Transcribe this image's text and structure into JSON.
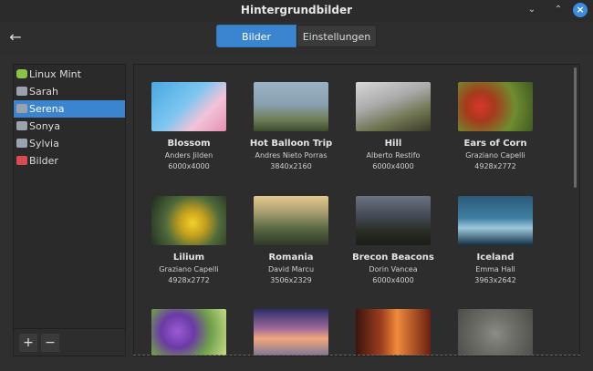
{
  "window": {
    "title": "Hintergrundbilder"
  },
  "header": {
    "back_icon": "arrow-left-icon",
    "tabs": [
      {
        "label": "Bilder",
        "active": true
      },
      {
        "label": "Einstellungen",
        "active": false
      }
    ]
  },
  "sidebar": {
    "items": [
      {
        "label": "Linux Mint",
        "icon": "linux-mint-icon",
        "active": false
      },
      {
        "label": "Sarah",
        "icon": "folder-icon",
        "active": false
      },
      {
        "label": "Serena",
        "icon": "folder-icon",
        "active": true
      },
      {
        "label": "Sonya",
        "icon": "folder-icon",
        "active": false
      },
      {
        "label": "Sylvia",
        "icon": "folder-icon",
        "active": false
      },
      {
        "label": "Bilder",
        "icon": "pictures-icon",
        "active": false
      }
    ],
    "footer": {
      "add_label": "+",
      "remove_label": "−"
    }
  },
  "wallpapers": [
    {
      "name": "Blossom",
      "author": "Anders Jilden",
      "resolution": "6000x4000"
    },
    {
      "name": "Hot Balloon Trip",
      "author": "Andres Nieto Porras",
      "resolution": "3840x2160"
    },
    {
      "name": "Hill",
      "author": "Alberto Restifo",
      "resolution": "6000x4000"
    },
    {
      "name": "Ears of Corn",
      "author": "Graziano Capelli",
      "resolution": "4928x2772"
    },
    {
      "name": "Lilium",
      "author": "Graziano Capelli",
      "resolution": "4928x2772"
    },
    {
      "name": "Romania",
      "author": "David Marcu",
      "resolution": "3506x2329"
    },
    {
      "name": "Brecon Beacons",
      "author": "Dorin Vancea",
      "resolution": "6000x4000"
    },
    {
      "name": "Iceland",
      "author": "Emma Hall",
      "resolution": "3963x2642"
    },
    {
      "name": "",
      "author": "",
      "resolution": ""
    },
    {
      "name": "",
      "author": "",
      "resolution": ""
    },
    {
      "name": "",
      "author": "",
      "resolution": ""
    },
    {
      "name": "",
      "author": "",
      "resolution": ""
    }
  ],
  "colors": {
    "accent": "#3b84d0",
    "background": "#2f2f2f"
  }
}
